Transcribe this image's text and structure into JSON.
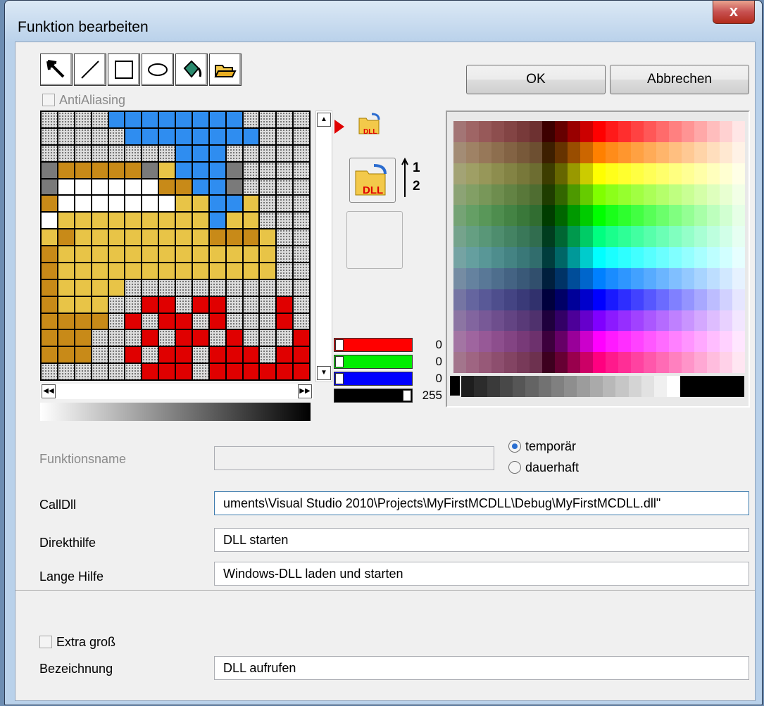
{
  "window": {
    "title": "Funktion bearbeiten",
    "close_glyph": "x"
  },
  "toolbar": {
    "tools": [
      {
        "name": "select-arrow-icon"
      },
      {
        "name": "line-tool-icon"
      },
      {
        "name": "rectangle-tool-icon"
      },
      {
        "name": "ellipse-tool-icon"
      },
      {
        "name": "fill-bucket-icon"
      },
      {
        "name": "open-folder-icon"
      }
    ]
  },
  "antialiasing": {
    "label": "AntiAliasing",
    "checked": false
  },
  "buttons": {
    "ok": "OK",
    "cancel": "Abbrechen"
  },
  "icon_size_labels": {
    "small": "1",
    "large": "2"
  },
  "dll_icon_text": "DLL",
  "sliders": {
    "red": {
      "value": "0",
      "color": "#ff0000"
    },
    "green": {
      "value": "0",
      "color": "#00ee00"
    },
    "blue": {
      "value": "0",
      "color": "#0000ff"
    },
    "alpha": {
      "value": "255",
      "color": "#000000"
    }
  },
  "form": {
    "funktionsname": {
      "label": "Funktionsname",
      "value": ""
    },
    "calldll": {
      "label": "CallDll",
      "value": "uments\\Visual Studio 2010\\Projects\\MyFirstMCDLL\\Debug\\MyFirstMCDLL.dll\""
    },
    "direkthilfe": {
      "label": "Direkthilfe",
      "value": "DLL starten"
    },
    "lange_hilfe": {
      "label": "Lange Hilfe",
      "value": "Windows-DLL laden und starten"
    },
    "extra_gross": {
      "label": "Extra groß",
      "checked": false
    },
    "bezeichnung": {
      "label": "Bezeichnung",
      "value": "DLL aufrufen"
    }
  },
  "radios": {
    "temporaer": {
      "label": "temporär",
      "selected": true
    },
    "dauerhaft": {
      "label": "dauerhaft",
      "selected": false
    }
  },
  "pixel_rows": [
    "tttt bbbbbbbbt tt",
    "tttttbbbbbbbbttt",
    "ttttttttbbbttttt",
    "gooooogybbbgtttt",
    "gwwwwwwoobbgtttt",
    "owwwwwwwyybbyttt",
    "wyyyyyyyyybyyttt",
    "yoyyyyyyyyoooytt",
    "oyyyyyyyyyyyyytt",
    "oyyyyyyyyyyyyytt",
    "oyyyyttttttttttt",
    "oyyyttrrtrrtttrt",
    "ooootrtrrtrtttrt",
    "oootttrtrrtrtttr",
    "ooottrtrrtrrrtrr",
    "ttttttrrrtrrrrrr"
  ]
}
